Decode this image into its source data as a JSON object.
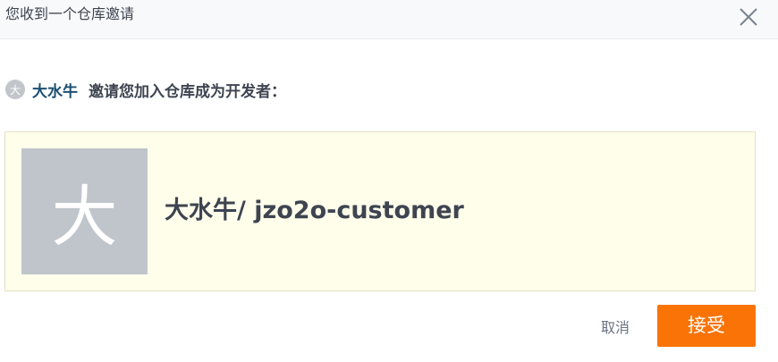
{
  "header": {
    "title": "您收到一个仓库邀请",
    "close_icon": "close-icon"
  },
  "invite": {
    "avatar_letter": "大",
    "inviter_name": "大水牛",
    "message": "邀请您加入仓库成为开发者："
  },
  "repo": {
    "avatar_letter": "大",
    "full_name": "大水牛/ jzo2o-customer"
  },
  "actions": {
    "cancel_label": "取消",
    "accept_label": "接受"
  },
  "colors": {
    "accent": "#f97306",
    "link": "#1b4f72",
    "card_bg": "#fffeeb",
    "avatar_bg": "#bfc5ca"
  }
}
